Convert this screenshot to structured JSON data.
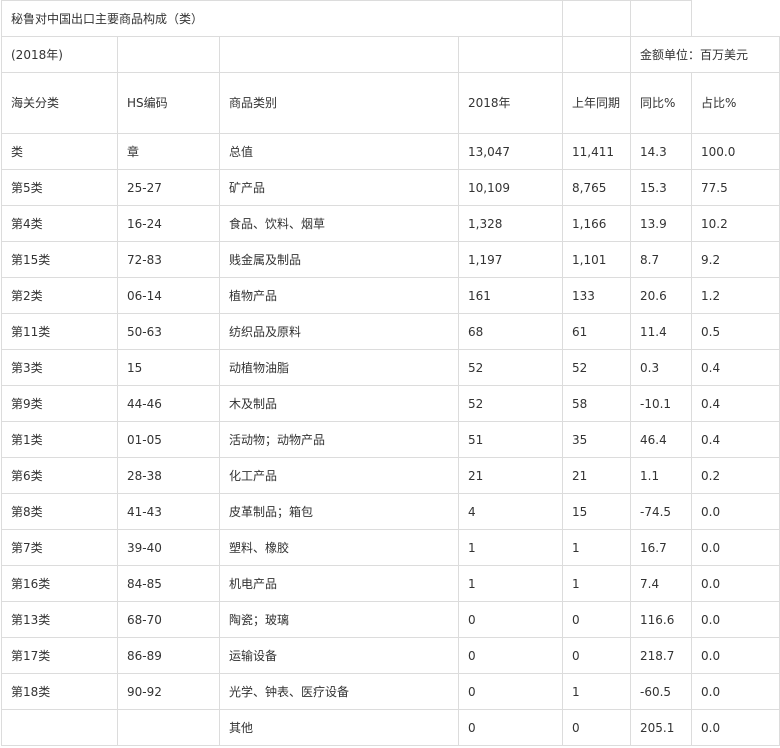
{
  "title": "秘鲁对中国出口主要商品构成（类）",
  "year": "(2018年)",
  "unit": "金额单位：百万美元",
  "headers": [
    "海关分类",
    "HS编码",
    "商品类别",
    "2018年",
    "上年同期",
    "同比%",
    "占比%"
  ],
  "rows": [
    [
      "类",
      "章",
      "总值",
      "13,047",
      "11,411",
      "14.3",
      "100.0"
    ],
    [
      "第5类",
      "25-27",
      "矿产品",
      "10,109",
      "8,765",
      "15.3",
      "77.5"
    ],
    [
      "第4类",
      "16-24",
      "食品、饮料、烟草",
      "1,328",
      "1,166",
      "13.9",
      "10.2"
    ],
    [
      "第15类",
      "72-83",
      "贱金属及制品",
      "1,197",
      "1,101",
      "8.7",
      "9.2"
    ],
    [
      "第2类",
      "06-14",
      "植物产品",
      "161",
      "133",
      "20.6",
      "1.2"
    ],
    [
      "第11类",
      "50-63",
      "纺织品及原料",
      "68",
      "61",
      "11.4",
      "0.5"
    ],
    [
      "第3类",
      "15",
      "动植物油脂",
      "52",
      "52",
      "0.3",
      "0.4"
    ],
    [
      "第9类",
      "44-46",
      "木及制品",
      "52",
      "58",
      "-10.1",
      "0.4"
    ],
    [
      "第1类",
      "01-05",
      "活动物；动物产品",
      "51",
      "35",
      "46.4",
      "0.4"
    ],
    [
      "第6类",
      "28-38",
      "化工产品",
      "21",
      "21",
      "1.1",
      "0.2"
    ],
    [
      "第8类",
      "41-43",
      "皮革制品；箱包",
      "4",
      "15",
      "-74.5",
      "0.0"
    ],
    [
      "第7类",
      "39-40",
      "塑料、橡胶",
      "1",
      "1",
      "16.7",
      "0.0"
    ],
    [
      "第16类",
      "84-85",
      "机电产品",
      "1",
      "1",
      "7.4",
      "0.0"
    ],
    [
      "第13类",
      "68-70",
      "陶瓷；玻璃",
      "0",
      "0",
      "116.6",
      "0.0"
    ],
    [
      "第17类",
      "86-89",
      "运输设备",
      "0",
      "0",
      "218.7",
      "0.0"
    ],
    [
      "第18类",
      "90-92",
      "光学、钟表、医疗设备",
      "0",
      "1",
      "-60.5",
      "0.0"
    ],
    [
      "",
      "",
      "其他",
      "0",
      "0",
      "205.1",
      "0.0"
    ]
  ]
}
